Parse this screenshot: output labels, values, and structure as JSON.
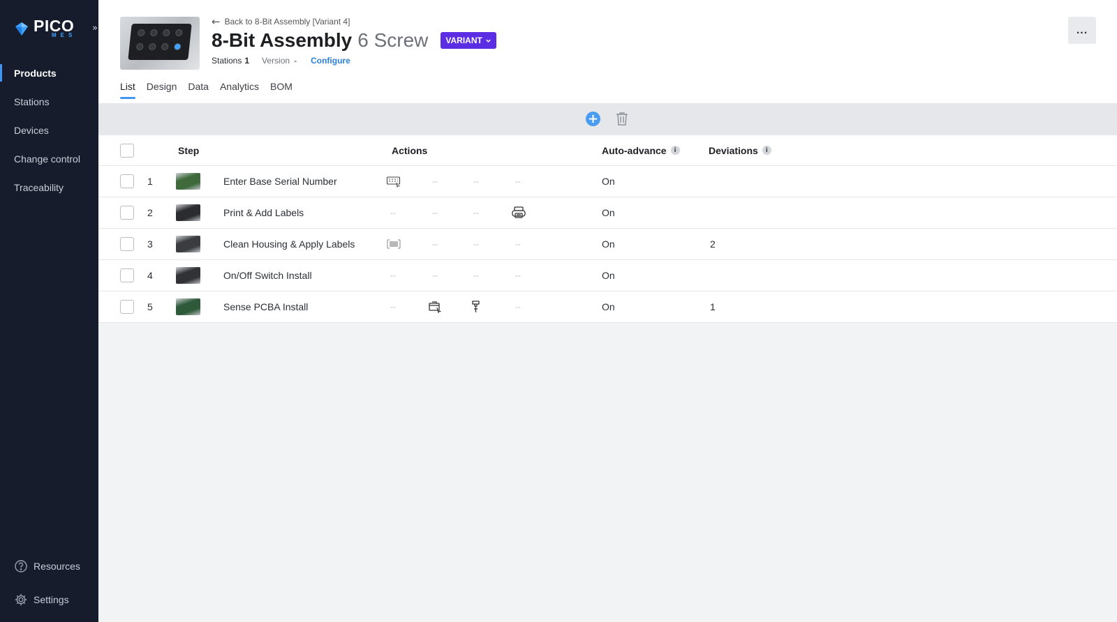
{
  "app": {
    "logo_text": "PICO",
    "logo_sub": "MES"
  },
  "sidebar": {
    "items": [
      {
        "label": "Products",
        "active": true
      },
      {
        "label": "Stations",
        "active": false
      },
      {
        "label": "Devices",
        "active": false
      },
      {
        "label": "Change control",
        "active": false
      },
      {
        "label": "Traceability",
        "active": false
      }
    ],
    "resources_label": "Resources",
    "settings_label": "Settings"
  },
  "header": {
    "back_label": "Back to 8-Bit Assembly [Variant 4]",
    "title": "8-Bit Assembly",
    "subtitle": "6 Screw",
    "badge": "VARIANT",
    "stations_label": "Stations",
    "stations_value": "1",
    "version_label": "Version",
    "version_value": "-",
    "configure_label": "Configure",
    "more_label": "..."
  },
  "tabs": [
    {
      "label": "List",
      "active": true
    },
    {
      "label": "Design",
      "active": false
    },
    {
      "label": "Data",
      "active": false
    },
    {
      "label": "Analytics",
      "active": false
    },
    {
      "label": "BOM",
      "active": false
    }
  ],
  "toolbar": {
    "add_label": "+"
  },
  "table": {
    "columns": {
      "step": "Step",
      "actions": "Actions",
      "auto_advance": "Auto-advance",
      "deviations": "Deviations"
    },
    "info_glyph": "i",
    "dash": "--",
    "rows": [
      {
        "num": "1",
        "name": "Enter Base Serial Number",
        "actions": [
          "keyboard-icon",
          "-",
          "-",
          "-"
        ],
        "auto": "On",
        "deviations": "",
        "thumb": "#3f6a3c"
      },
      {
        "num": "2",
        "name": "Print & Add Labels",
        "actions": [
          "-",
          "-",
          "-",
          "printer-icon"
        ],
        "auto": "On",
        "deviations": "",
        "thumb": "#2a2c2f"
      },
      {
        "num": "3",
        "name": "Clean Housing & Apply Labels",
        "actions": [
          "barcode-icon",
          "-",
          "-",
          "-"
        ],
        "auto": "On",
        "deviations": "2",
        "thumb": "#3a3c40"
      },
      {
        "num": "4",
        "name": "On/Off Switch Install",
        "actions": [
          "-",
          "-",
          "-",
          "-"
        ],
        "auto": "On",
        "deviations": "",
        "thumb": "#303236"
      },
      {
        "num": "5",
        "name": "Sense PCBA Install",
        "actions": [
          "-",
          "box-hand-icon",
          "screwdriver-icon",
          "-"
        ],
        "auto": "On",
        "deviations": "1",
        "thumb": "#2f5a3a"
      }
    ]
  }
}
